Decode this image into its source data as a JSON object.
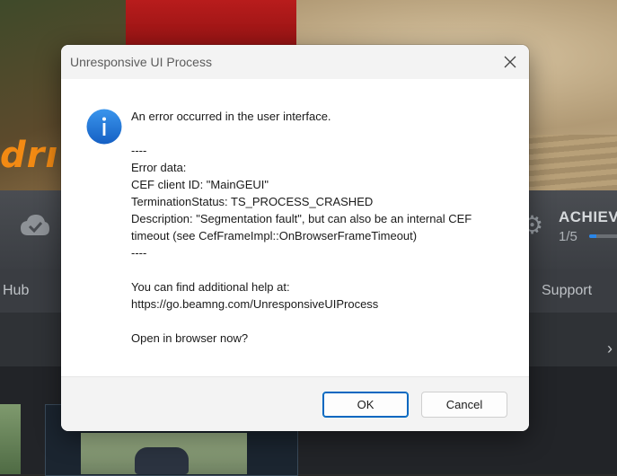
{
  "background": {
    "logo_text": "drı",
    "achievements": {
      "label": "ACHIEV",
      "count": "1/5",
      "progress": 0.2,
      "accent": "#2a86e8"
    },
    "nav": {
      "hub": "Hub",
      "support": "Support"
    },
    "icons": {
      "cloud": "cloud-check-icon",
      "gear": "gear-icon",
      "chevron": "chevron-right-icon"
    }
  },
  "dialog": {
    "title": "Unresponsive UI Process",
    "icon": "info-icon",
    "accent": "#1e73d8",
    "message": {
      "line1": "An error occurred in the user interface.",
      "sep1": "----",
      "error_heading": "Error data:",
      "client_id": "CEF client ID: \"MainGEUI\"",
      "termination": "TerminationStatus: TS_PROCESS_CRASHED",
      "description": "Description: \"Segmentation fault\", but can also be an internal CEF timeout (see CefFrameImpl::OnBrowserFrameTimeout)",
      "sep2": "----",
      "help_intro": "You can find additional help at:",
      "help_url": "https://go.beamng.com/UnresponsiveUIProcess",
      "question": "Open in browser now?"
    },
    "buttons": {
      "ok": "OK",
      "cancel": "Cancel"
    }
  }
}
